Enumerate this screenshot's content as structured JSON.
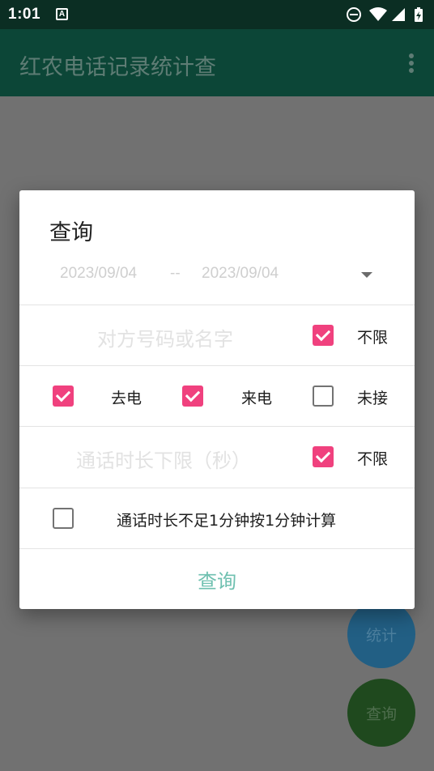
{
  "status_bar": {
    "time": "1:01",
    "notification_icon": "A"
  },
  "app_bar": {
    "title": "红农电话记录统计查"
  },
  "fabs": {
    "stats_label": "统计",
    "query_label": "查询"
  },
  "dialog": {
    "title": "查询",
    "date_range": {
      "from": "2023/09/04",
      "separator": "--",
      "to": "2023/09/04"
    },
    "contact": {
      "placeholder": "对方号码或名字",
      "unlimited_label": "不限",
      "unlimited_checked": true
    },
    "call_types": [
      {
        "label": "去电",
        "checked": true
      },
      {
        "label": "来电",
        "checked": true
      },
      {
        "label": "未接",
        "checked": false
      }
    ],
    "duration": {
      "placeholder": "通话时长下限（秒）",
      "unlimited_label": "不限",
      "unlimited_checked": true
    },
    "round_up": {
      "label": "通话时长不足1分钟按1分钟计算",
      "checked": false
    },
    "submit_label": "查询"
  },
  "colors": {
    "checkbox_checked": "#f0417e",
    "submit_text": "#6fc0b0",
    "app_bar": "#0c4637"
  }
}
